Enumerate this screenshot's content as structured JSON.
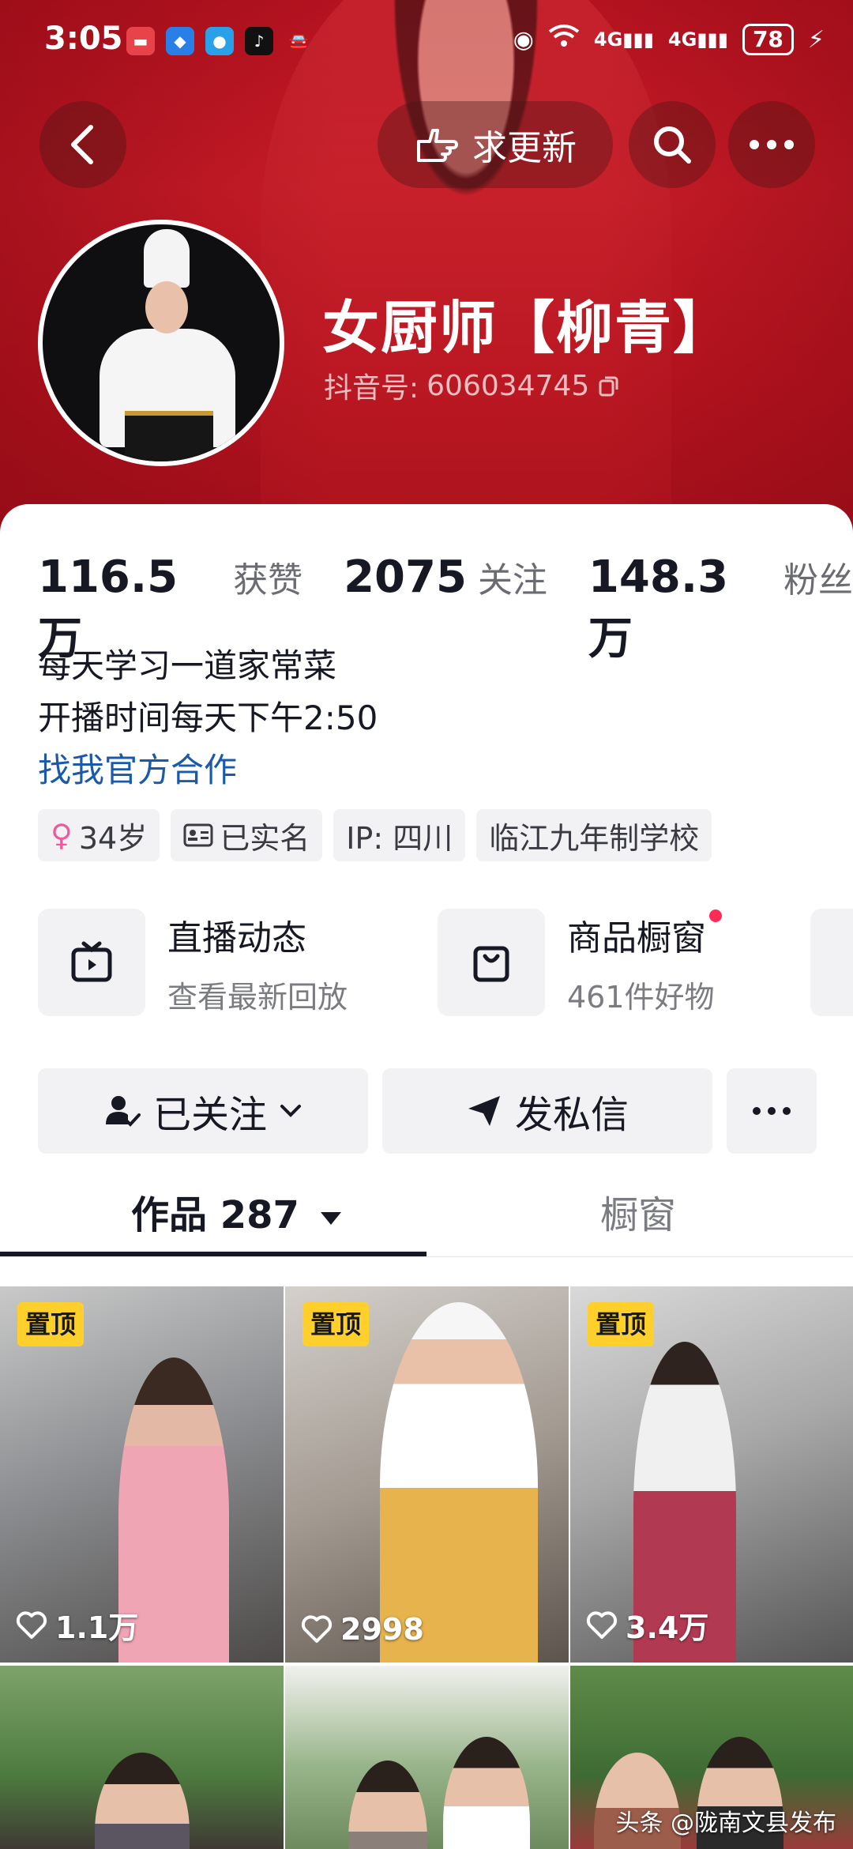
{
  "status_bar": {
    "time": "3:05",
    "battery": "78"
  },
  "header": {
    "update_label": "求更新"
  },
  "profile": {
    "name": "女厨师【柳青】",
    "douyin_id_label": "抖音号: ",
    "douyin_id": "606034745"
  },
  "stats": [
    {
      "value": "116.5万",
      "label": "获赞"
    },
    {
      "value": "2075",
      "label": "关注"
    },
    {
      "value": "148.3万",
      "label": "粉丝"
    }
  ],
  "bio": {
    "line1": "每天学习一道家常菜",
    "line2": "开播时间每天下午2:50",
    "link": "找我官方合作"
  },
  "tags": [
    "34岁",
    "已实名",
    "IP:  四川",
    "临江九年制学校"
  ],
  "features": [
    {
      "title": "直播动态",
      "subtitle": "查看最新回放"
    },
    {
      "title": "商品橱窗",
      "subtitle": "461件好物"
    }
  ],
  "actions": {
    "follow": "已关注",
    "message": "发私信"
  },
  "tabs": {
    "works": "作品 287",
    "showcase": "橱窗"
  },
  "videos": [
    {
      "pinned": "置顶",
      "likes": "1.1万"
    },
    {
      "pinned": "置顶",
      "likes": "2998"
    },
    {
      "pinned": "置顶",
      "likes": "3.4万"
    },
    {
      "pinned": "",
      "likes": ""
    },
    {
      "pinned": "",
      "likes": ""
    },
    {
      "pinned": "",
      "likes": ""
    }
  ],
  "watermark": "头条 @陇南文县发布",
  "colors": {
    "brand_red": "#c81c28",
    "link_blue": "#1a5aa8",
    "pin_yellow": "#ffd02b",
    "dot_red": "#fe2c55"
  }
}
